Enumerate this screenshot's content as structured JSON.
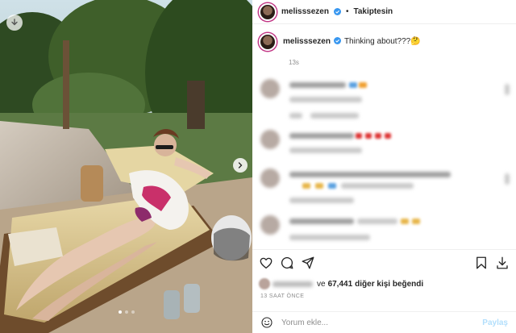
{
  "post": {
    "username": "melisssezen",
    "separator": "•",
    "follow_state": "Takiptesin",
    "caption": "Thinking about???🤔",
    "caption_time": "13s",
    "likes": {
      "suffix_prefix": "ve",
      "count": "67,441",
      "suffix": "diğer kişi beğendi"
    },
    "date": "13 SAAT ÖNCE"
  },
  "comment_box": {
    "placeholder": "Yorum ekle...",
    "post_label": "Paylaş"
  },
  "photo": {
    "carousel_count": 3,
    "carousel_active": 1
  },
  "icons": {
    "header_verified": "verified-badge-icon",
    "like": "heart-icon",
    "comment": "comment-bubble-icon",
    "share": "paper-plane-icon",
    "save": "bookmark-icon",
    "download": "download-icon",
    "emoji": "emoji-smile-icon"
  },
  "colors": {
    "accent": "#0095f6",
    "verified": "#3897f0",
    "post_button": "#b2dffc",
    "story_ring": "#c13584"
  }
}
